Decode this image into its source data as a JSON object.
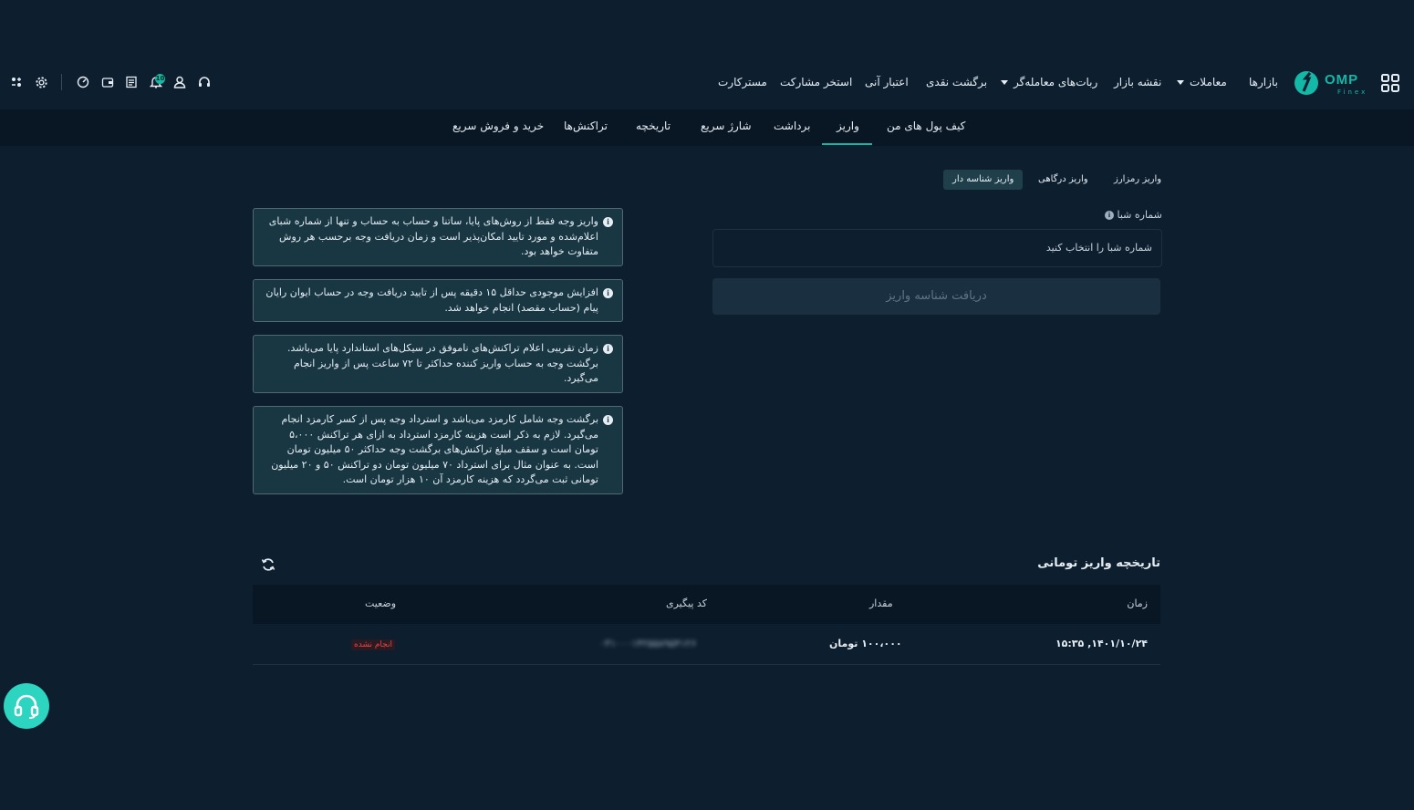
{
  "header": {
    "logo_text": "OMP",
    "logo_sub": "Finex",
    "nav": [
      {
        "label": "بازارها",
        "dropdown": false
      },
      {
        "label": "معاملات",
        "dropdown": true
      },
      {
        "label": "نقشه بازار",
        "dropdown": false
      },
      {
        "label": "ربات‌های معامله‌گر",
        "dropdown": true
      },
      {
        "label": "برگشت نقدی",
        "dropdown": false
      },
      {
        "label": "اعتبار آنی",
        "dropdown": false
      },
      {
        "label": "استخر مشارکت",
        "dropdown": false
      },
      {
        "label": "مسترکارت",
        "dropdown": false
      }
    ],
    "notification_count": "10",
    "icons": [
      "support-icon",
      "user-icon",
      "bell-icon",
      "orders-icon",
      "wallet-icon",
      "dashboard-icon",
      "settings-icon",
      "theme-icon",
      "apps-grid-icon"
    ]
  },
  "tabs": [
    {
      "label": "کیف پول های من",
      "active": false
    },
    {
      "label": "واریز",
      "active": true
    },
    {
      "label": "برداشت",
      "active": false
    },
    {
      "label": "شارژ سریع",
      "active": false
    },
    {
      "label": "تاریخچه",
      "active": false
    },
    {
      "label": "تراکنش‌ها",
      "active": false
    },
    {
      "label": "خرید و فروش سریع",
      "active": false
    }
  ],
  "deposit": {
    "methods": [
      {
        "label": "واریز رمزارز",
        "active": false
      },
      {
        "label": "واریز درگاهی",
        "active": false
      },
      {
        "label": "واریز شناسه دار",
        "active": true
      }
    ],
    "sheba_label": "شماره شبا",
    "sheba_placeholder": "شماره شبا را انتخاب کنید",
    "submit_label": "دریافت شناسه واریز"
  },
  "notes": [
    "واریز وجه فقط از روش‌های پایا، ساتنا و حساب به حساب و تنها از شماره شبای اعلام‌شده و مورد تایید امکان‌پذیر است و زمان دریافت وجه برحسب هر روش متفاوت خواهد بود.",
    "افزایش موجودی حداقل ۱۵ دقیقه پس از تایید دریافت وجه در حساب ایوان رایان پیام (حساب مقصد) انجام خواهد شد.",
    "زمان تقریبی اعلام تراکنش‌های ناموفق در سیکل‌های استاندارد پایا می‌باشد. برگشت وجه به حساب واریز کننده حداکثر تا ۷۲ ساعت پس از واریز انجام می‌گیرد.",
    "برگشت وجه شامل کارمزد می‌باشد و استرداد وجه پس از کسر کارمزد انجام می‌گیرد. لازم به ذکر است هزینه کارمزد استرداد به ازای هر تراکنش ۵،۰۰۰ تومان است و سقف مبلغ تراکنش‌های برگشت وجه حداکثر ۵۰ میلیون تومان است. به عنوان مثال برای استرداد ۷۰ میلیون تومان دو تراکنش ۵۰ و ۲۰ میلیون تومانی ثبت می‌گردد که هزینه کارمزد آن ۱۰ هزار تومان است."
  ],
  "history": {
    "title": "تاریخچه واریز تومانی",
    "columns": {
      "time": "زمان",
      "amount": "مقدار",
      "tracking": "کد پیگیری",
      "status": "وضعیت"
    },
    "rows": [
      {
        "time": "۱۴۰۱/۱۰/۲۴, ۱۵:۳۵",
        "amount": "۱۰۰،۰۰۰ تومان",
        "tracking": "۰۳۱۰۰۰۱۴۲۵۵۸۹۵۴۱۲۶",
        "status": "انجام نشده"
      }
    ]
  },
  "colors": {
    "accent": "#14b8a6",
    "background": "#0d1e2f",
    "danger": "#ef4444"
  }
}
